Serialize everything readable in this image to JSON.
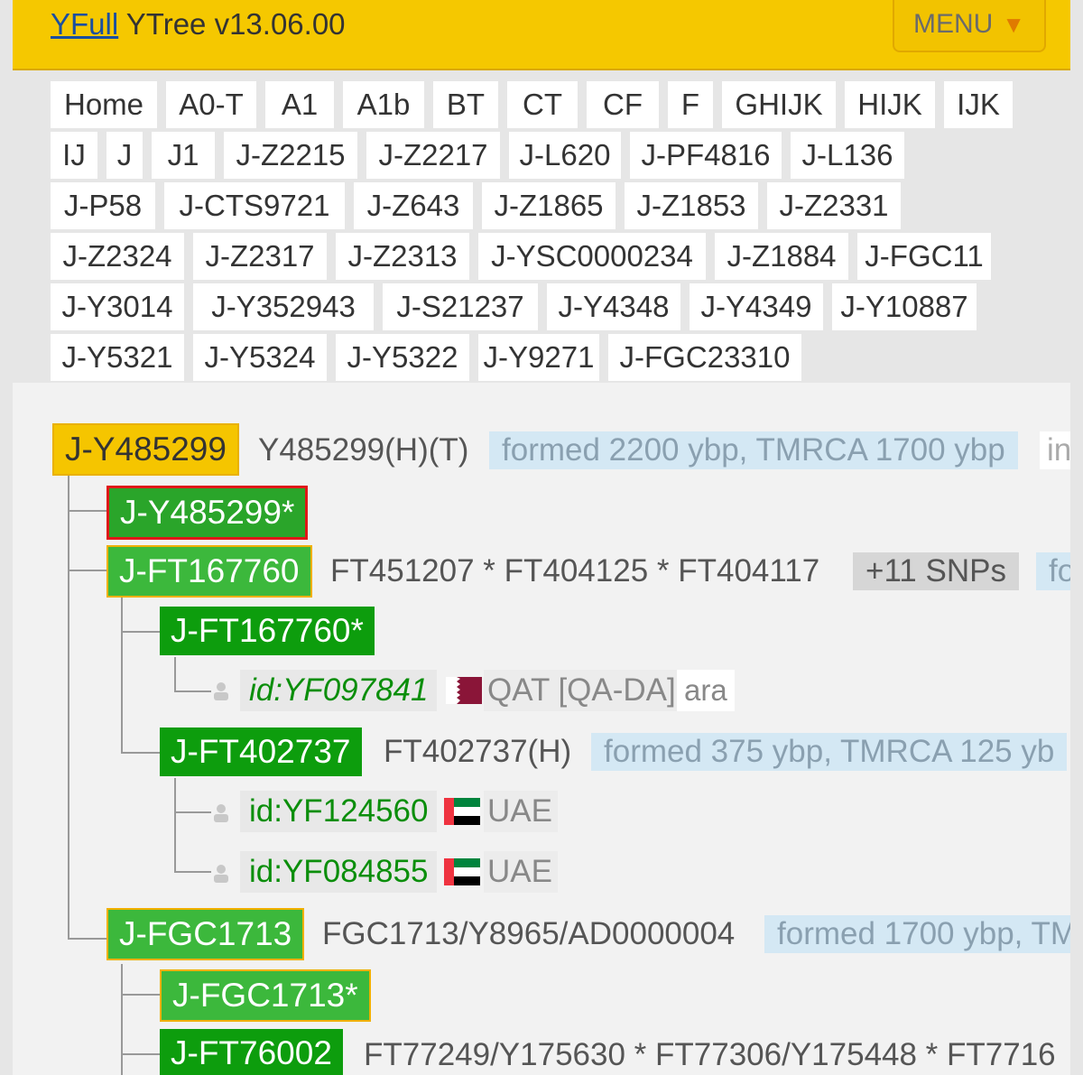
{
  "header": {
    "brand_link": "YFull",
    "brand_text": "YTree v13.06.00",
    "menu_label": "MENU",
    "menu_arrow": "▼"
  },
  "breadcrumbs": [
    [
      "Home",
      "A0-T",
      "A1",
      "A1b",
      "BT",
      "CT",
      "CF",
      "F",
      "GHIJK",
      "HIJK",
      "IJK"
    ],
    [
      "IJ",
      "J",
      "J1",
      "J-Z2215",
      "J-Z2217",
      "J-L620",
      "J-PF4816",
      "J-L136"
    ],
    [
      "J-P58",
      "J-CTS9721",
      "J-Z643",
      "J-Z1865",
      "J-Z1853",
      "J-Z2331"
    ],
    [
      "J-Z2324",
      "J-Z2317",
      "J-Z2313",
      "J-YSC0000234",
      "J-Z1884",
      "J-FGC11"
    ],
    [
      "J-Y3014",
      "J-Y352943",
      "J-S21237",
      "J-Y4348",
      "J-Y4349",
      "J-Y10887"
    ],
    [
      "J-Y5321",
      "J-Y5324",
      "J-Y5322",
      "J-Y9271",
      "J-FGC23310"
    ]
  ],
  "tree": {
    "root": {
      "label": "J-Y485299",
      "snp": "Y485299(H)(T)",
      "formed": "formed 2200 ybp, TMRCA 1700 ybp",
      "info": "in"
    },
    "root_star": {
      "label": "J-Y485299*"
    },
    "ft167760": {
      "label": "J-FT167760",
      "snp": "FT451207 * FT404125 * FT404117",
      "snp_count": "+11 SNPs",
      "formed": "fo"
    },
    "ft167760_star": {
      "label": "J-FT167760*",
      "sample": "id:YF097841",
      "country": "QAT [QA-DA]",
      "lang": "ara"
    },
    "ft402737": {
      "label": "J-FT402737",
      "snp": "FT402737(H)",
      "formed": "formed 375 ybp, TMRCA 125 yb",
      "samples": [
        {
          "id": "id:YF124560",
          "country": "UAE"
        },
        {
          "id": "id:YF084855",
          "country": "UAE"
        }
      ]
    },
    "fgc1713": {
      "label": "J-FGC1713",
      "snp": "FGC1713/Y8965/AD0000004",
      "formed": "formed 1700 ybp, TM"
    },
    "fgc1713_star": {
      "label": "J-FGC1713*"
    },
    "ft76002": {
      "label": "J-FT76002",
      "snp": "FT77249/Y175630 * FT77306/Y175448 * FT7716"
    }
  },
  "colors": {
    "header_bg": "#f5c800",
    "root_node": "#f5c500",
    "light_green_node": "#3cb83c",
    "dark_green_node": "#0d9d0d",
    "formed_bg": "#d4e8f4",
    "sample_text": "#0b8e0b"
  },
  "icons": {
    "person": "person-icon",
    "flag_qatar": "qatar-flag-icon",
    "flag_uae": "uae-flag-icon"
  }
}
